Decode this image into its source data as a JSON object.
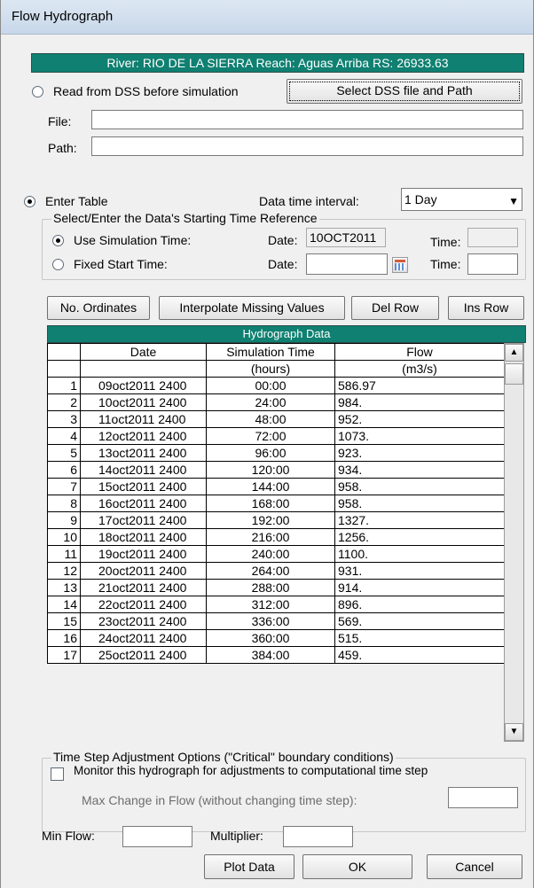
{
  "window": {
    "title": "Flow Hydrograph"
  },
  "banner": "River: RIO DE LA SIERRA  Reach: Aguas Arriba  RS: 26933.63",
  "dss": {
    "radio_label": "Read from DSS before simulation",
    "select_button": "Select DSS file and Path",
    "file_label": "File:",
    "file_value": "",
    "path_label": "Path:",
    "path_value": ""
  },
  "enter_table": {
    "radio_label": "Enter Table",
    "interval_label": "Data time interval:",
    "interval_value": "1 Day"
  },
  "time_ref": {
    "caption": "Select/Enter the Data's Starting Time Reference",
    "use_sim_label": "Use Simulation Time:",
    "use_sim_date_label": "Date:",
    "use_sim_date_value": "10OCT2011",
    "use_sim_time_label": "Time:",
    "use_sim_time_value": "",
    "fixed_label": "Fixed Start Time:",
    "fixed_date_label": "Date:",
    "fixed_date_value": "",
    "fixed_time_label": "Time:",
    "fixed_time_value": ""
  },
  "toolbar": {
    "ordinates": "No. Ordinates",
    "interpolate": "Interpolate Missing Values",
    "del_row": "Del Row",
    "ins_row": "Ins Row"
  },
  "table": {
    "title": "Hydrograph Data",
    "columns": [
      "Date",
      "Simulation Time",
      "Flow"
    ],
    "units": [
      "",
      "(hours)",
      "(m3/s)"
    ],
    "rows": [
      {
        "n": "1",
        "date": "09oct2011 2400",
        "time": "00:00",
        "flow": "586.97"
      },
      {
        "n": "2",
        "date": "10oct2011 2400",
        "time": "24:00",
        "flow": "984."
      },
      {
        "n": "3",
        "date": "11oct2011 2400",
        "time": "48:00",
        "flow": "952."
      },
      {
        "n": "4",
        "date": "12oct2011 2400",
        "time": "72:00",
        "flow": "1073."
      },
      {
        "n": "5",
        "date": "13oct2011 2400",
        "time": "96:00",
        "flow": "923."
      },
      {
        "n": "6",
        "date": "14oct2011 2400",
        "time": "120:00",
        "flow": "934."
      },
      {
        "n": "7",
        "date": "15oct2011 2400",
        "time": "144:00",
        "flow": "958."
      },
      {
        "n": "8",
        "date": "16oct2011 2400",
        "time": "168:00",
        "flow": "958."
      },
      {
        "n": "9",
        "date": "17oct2011 2400",
        "time": "192:00",
        "flow": "1327."
      },
      {
        "n": "10",
        "date": "18oct2011 2400",
        "time": "216:00",
        "flow": "1256."
      },
      {
        "n": "11",
        "date": "19oct2011 2400",
        "time": "240:00",
        "flow": "1100."
      },
      {
        "n": "12",
        "date": "20oct2011 2400",
        "time": "264:00",
        "flow": "931."
      },
      {
        "n": "13",
        "date": "21oct2011 2400",
        "time": "288:00",
        "flow": "914."
      },
      {
        "n": "14",
        "date": "22oct2011 2400",
        "time": "312:00",
        "flow": "896."
      },
      {
        "n": "15",
        "date": "23oct2011 2400",
        "time": "336:00",
        "flow": "569."
      },
      {
        "n": "16",
        "date": "24oct2011 2400",
        "time": "360:00",
        "flow": "515."
      },
      {
        "n": "17",
        "date": "25oct2011 2400",
        "time": "384:00",
        "flow": "459."
      }
    ]
  },
  "time_step": {
    "caption": "Time Step Adjustment Options (\"Critical\" boundary conditions)",
    "monitor_label": "Monitor this hydrograph for adjustments to computational time step",
    "max_change_label": "Max Change in Flow (without changing time step):",
    "max_change_value": ""
  },
  "bottom": {
    "min_flow_label": "Min Flow:",
    "min_flow_value": "",
    "multiplier_label": "Multiplier:",
    "multiplier_value": "",
    "plot": "Plot Data",
    "ok": "OK",
    "cancel": "Cancel"
  }
}
